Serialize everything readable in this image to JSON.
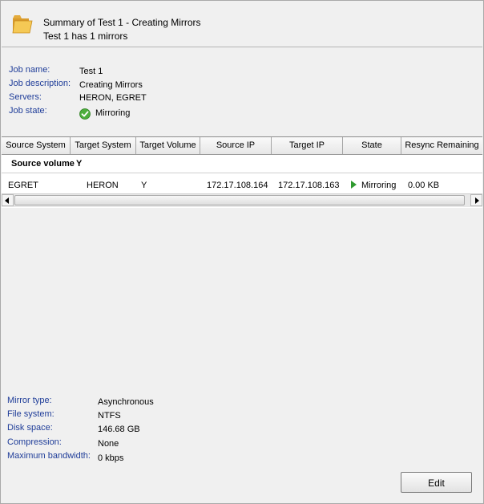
{
  "header": {
    "summary_prefix": "Summary of",
    "job_name": "Test 1",
    "separator": "-",
    "job_title": "Creating Mirrors",
    "line2_name": "Test 1",
    "line2_has": "has",
    "line2_count": "1",
    "line2_suffix": "mirrors"
  },
  "job_info": {
    "job_name_label": "Job name:",
    "job_name_value": "Test 1",
    "job_description_label": "Job description:",
    "job_description_value": "Creating Mirrors",
    "servers_label": "Servers:",
    "servers_value": "HERON, EGRET",
    "job_state_label": "Job state:",
    "job_state_value": "Mirroring"
  },
  "grid": {
    "columns": [
      "Source System",
      "Target System",
      "Target Volume",
      "Source IP",
      "Target IP",
      "State",
      "Resync Remaining"
    ],
    "group_label": "Source volume",
    "group_value": "Y",
    "rows": [
      {
        "source_system": "EGRET",
        "target_system": "HERON",
        "target_volume": "Y",
        "source_ip": "172.17.108.164",
        "target_ip": "172.17.108.163",
        "state": "Mirroring",
        "resync_remaining": "0.00 KB"
      }
    ]
  },
  "mirror_info": {
    "mirror_type_label": "Mirror type:",
    "mirror_type_value": "Asynchronous",
    "file_system_label": "File system:",
    "file_system_value": "NTFS",
    "disk_space_label": "Disk space:",
    "disk_space_value": "146.68 GB",
    "compression_label": "Compression:",
    "compression_value": "None",
    "max_bandwidth_label": "Maximum bandwidth:",
    "max_bandwidth_value": "0 kbps"
  },
  "actions": {
    "edit_label": "Edit"
  },
  "icons": {
    "header": "folder-icon",
    "job_state": "check-circle-icon",
    "row_state": "play-arrow-icon"
  },
  "colors": {
    "label": "#1f3d99",
    "state_ok": "#2f9a2f"
  }
}
